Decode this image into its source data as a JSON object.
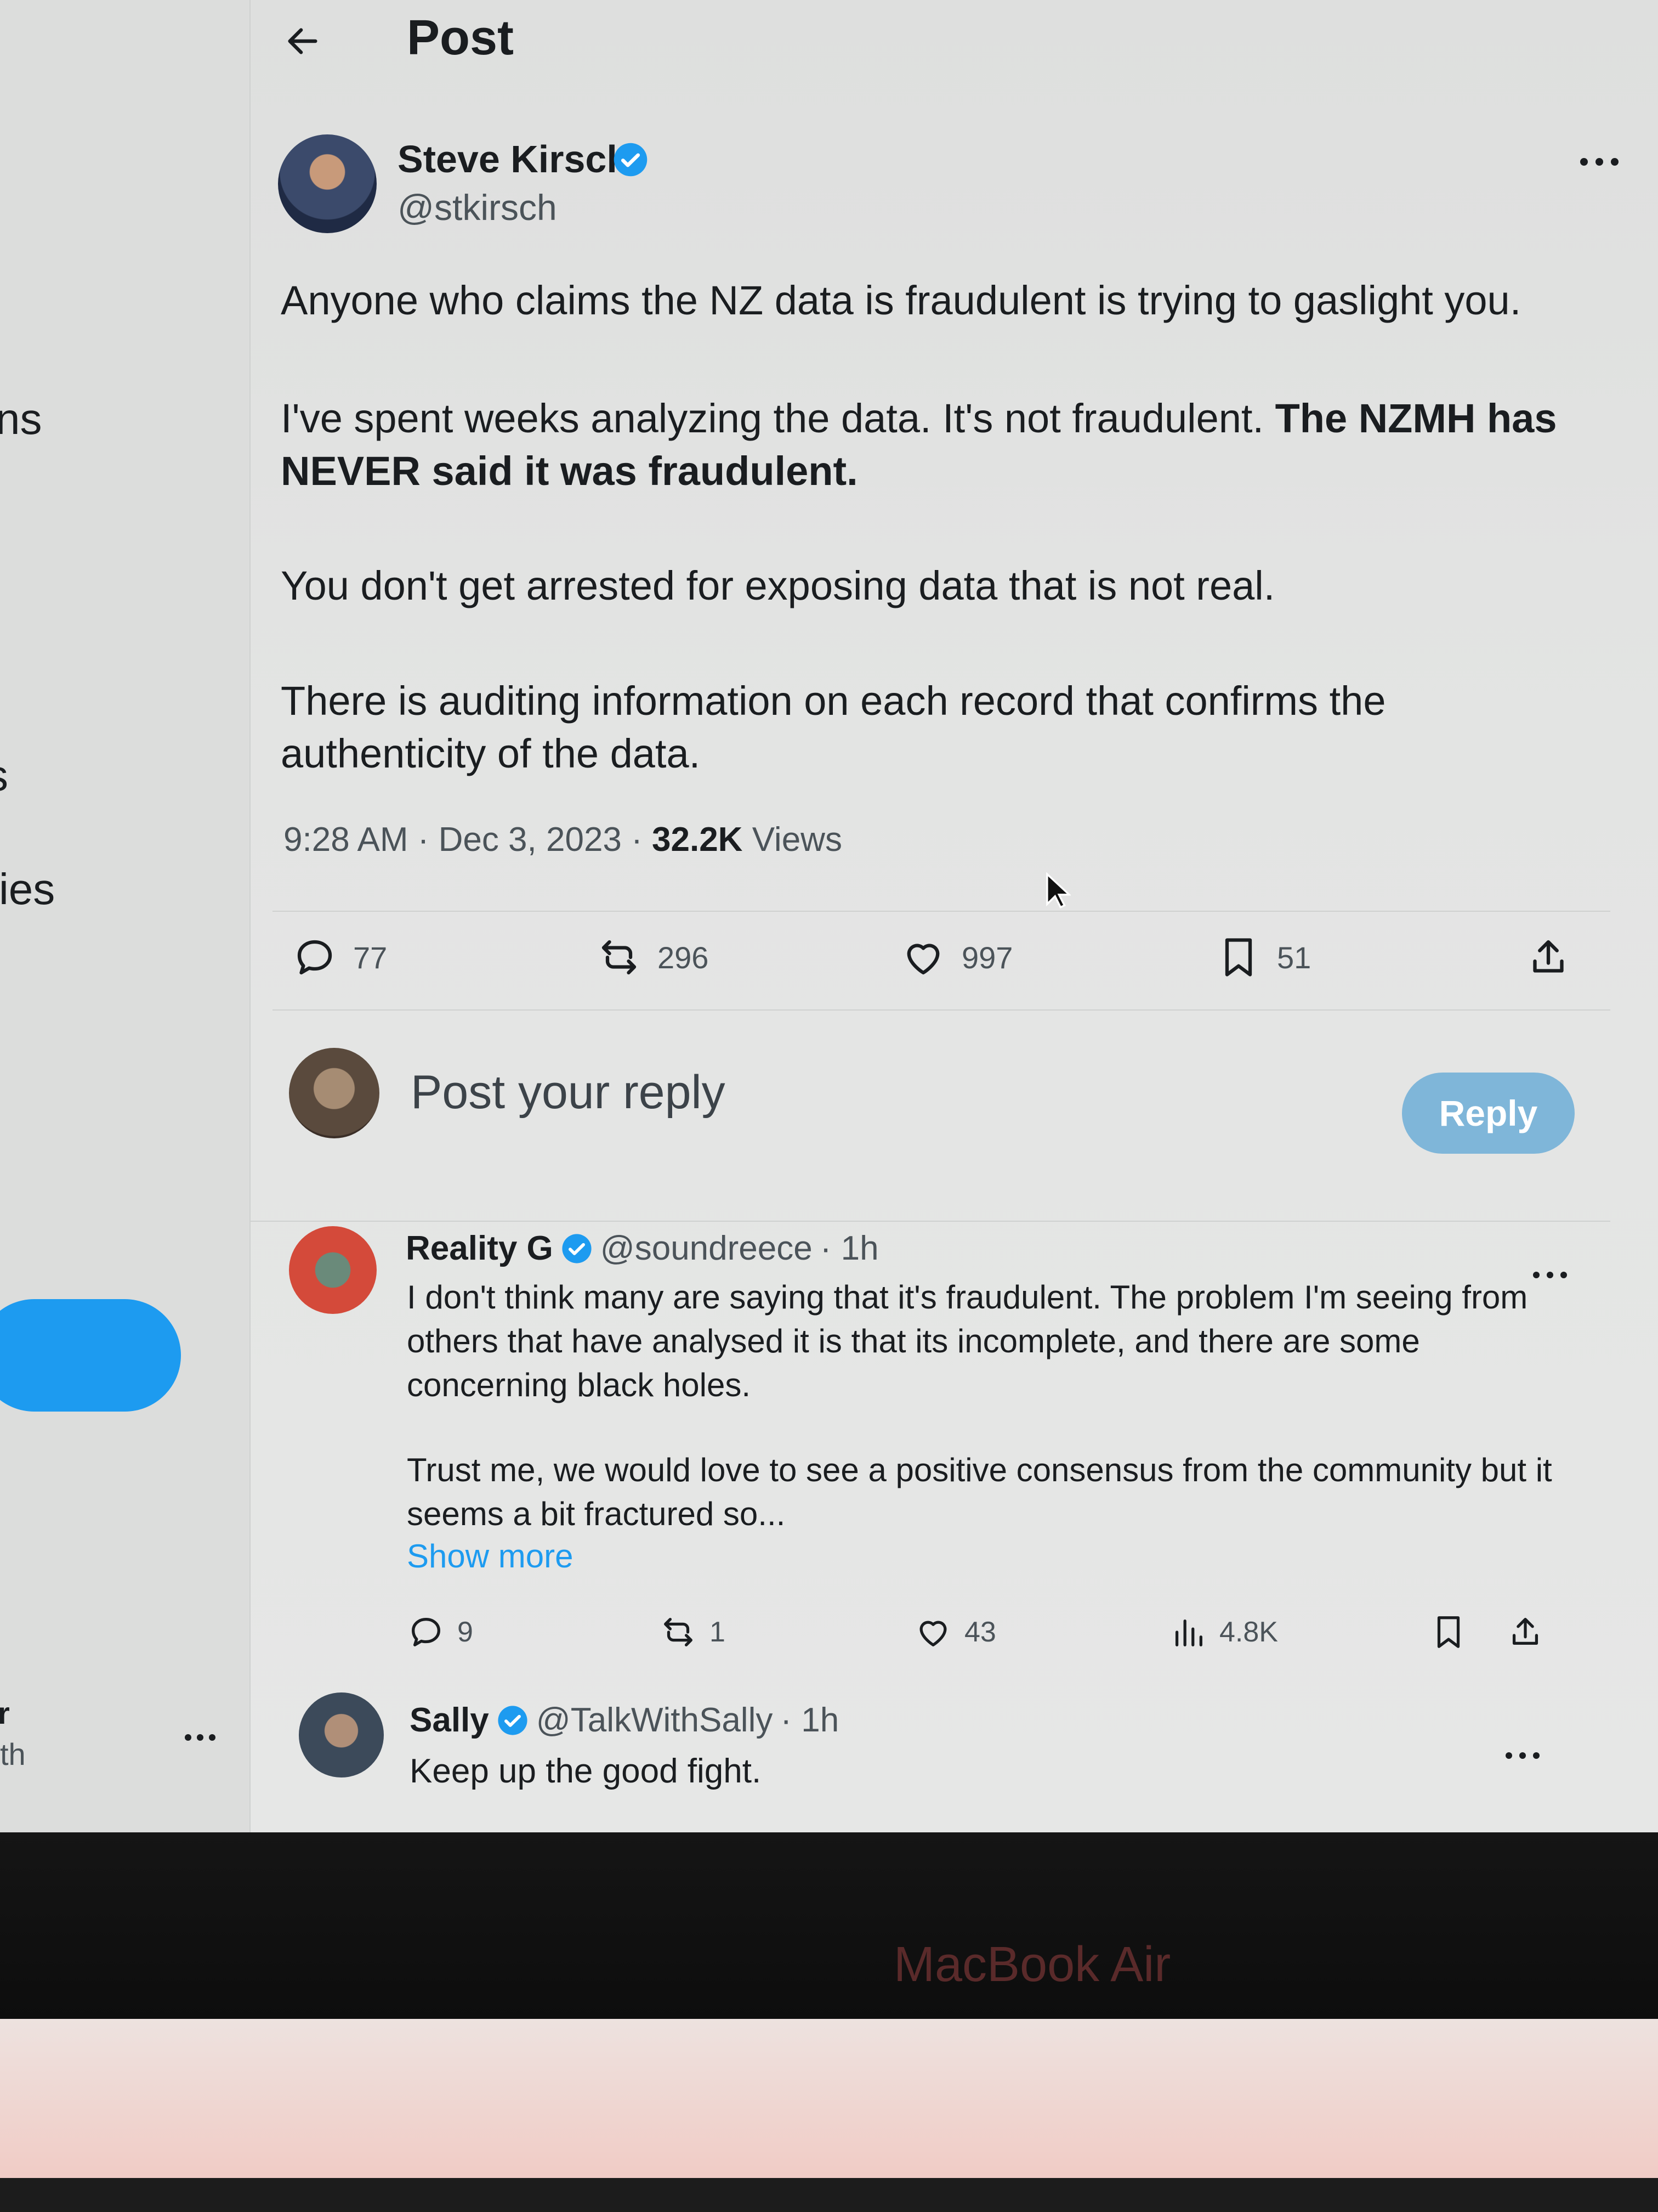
{
  "header": {
    "title": "Post"
  },
  "post": {
    "author_name": "Steve Kirsch",
    "author_handle": "@stkirsch",
    "paragraphs": {
      "p1": "Anyone who claims the NZ data is fraudulent is trying to gaslight you.",
      "p2_plain": "I've spent weeks analyzing the data. It's not fraudulent. ",
      "p2_bold": "The NZMH has NEVER said it was fraudulent.",
      "p3": "You don't get arrested for exposing data that is not real.",
      "p4": "There is auditing information on each record that confirms the authenticity of the data."
    },
    "timestamp": "9:28 AM · Dec 3, 2023 · ",
    "views_count": "32.2K",
    "views_label": " Views",
    "stats": {
      "replies": "77",
      "reposts": "296",
      "likes": "997",
      "bookmarks": "51"
    }
  },
  "composer": {
    "placeholder": "Post your reply",
    "button_label": "Reply"
  },
  "replies": [
    {
      "name": "Reality G",
      "handle": "@soundreece",
      "time": "· 1h",
      "text1": "I don't think many are saying that it's fraudulent. The problem I'm seeing from others that have analysed it is that its incomplete, and there are some concerning black holes.",
      "text2": "Trust me, we would love to see a positive consensus from the community but it seems a bit fractured so...",
      "show_more": "Show more",
      "stats": {
        "replies": "9",
        "reposts": "1",
        "likes": "43",
        "views": "4.8K"
      }
    },
    {
      "name": "Sally",
      "handle": "@TalkWithSally",
      "time": "· 1h",
      "text": "Keep up the good fight."
    }
  ],
  "left_fragments": [
    "ns",
    "s",
    "ies",
    "r",
    "th"
  ],
  "device_label": "MacBook Air",
  "colors": {
    "accent": "#1d9bf0",
    "reply_button_disabled": "#7fb6d9",
    "verified": "#1d9bf0"
  }
}
